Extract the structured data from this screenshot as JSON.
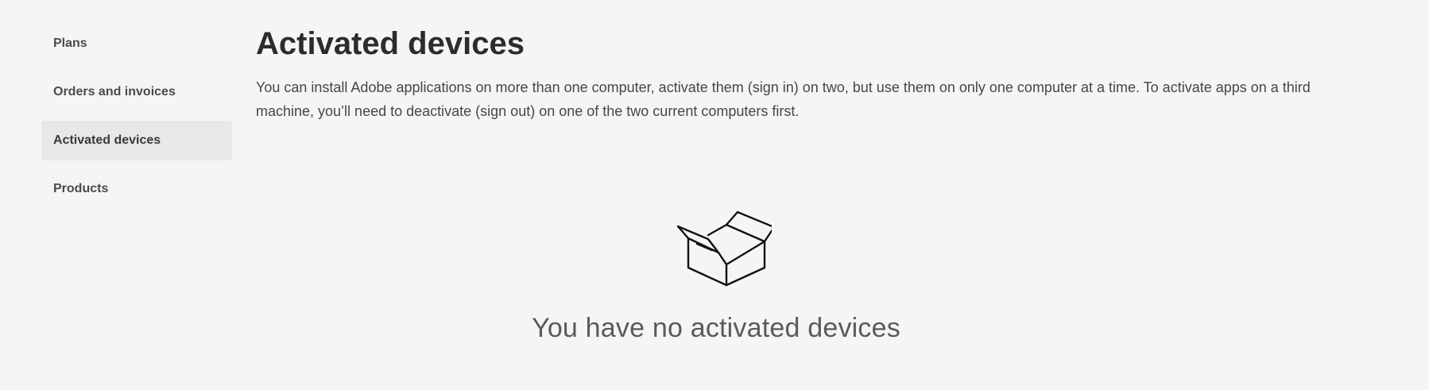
{
  "sidebar": {
    "items": [
      {
        "label": "Plans",
        "active": false
      },
      {
        "label": "Orders and invoices",
        "active": false
      },
      {
        "label": "Activated devices",
        "active": true
      },
      {
        "label": "Products",
        "active": false
      }
    ]
  },
  "main": {
    "title": "Activated devices",
    "description": "You can install Adobe applications on more than one computer, activate them (sign in) on two, but use them on only one computer at a time. To activate apps on a third machine, you’ll need to deactivate (sign out) on one of the two current computers first.",
    "empty_state": {
      "icon": "open-box-icon",
      "message": "You have no activated devices"
    }
  },
  "colors": {
    "background": "#f5f5f5",
    "active_nav_background": "#e8e8e8",
    "text_primary": "#2c2c2c"
  }
}
